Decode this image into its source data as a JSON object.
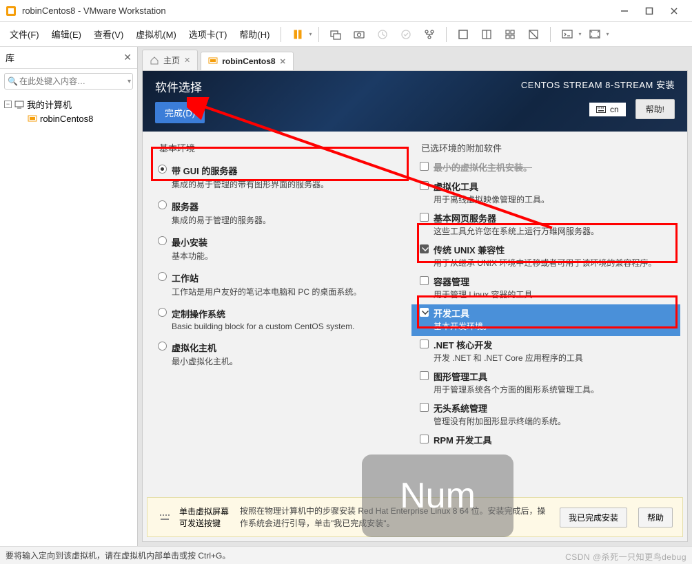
{
  "window": {
    "title": "robinCentos8 - VMware Workstation",
    "minimize": "—",
    "maximize": "□",
    "close": "✕"
  },
  "menu": {
    "file": "文件(F)",
    "edit": "编辑(E)",
    "view": "查看(V)",
    "vm": "虚拟机(M)",
    "tabs": "选项卡(T)",
    "help": "帮助(H)"
  },
  "sidebar": {
    "title": "库",
    "search_placeholder": "在此处键入内容…",
    "tree": {
      "root": "我的计算机",
      "child": "robinCentos8"
    }
  },
  "tabs": {
    "home": "主页",
    "vm": "robinCentos8"
  },
  "installer": {
    "title": "软件选择",
    "done": "完成(D)",
    "product": "CENTOS STREAM 8-STREAM 安装",
    "keyboard": "cn",
    "help": "帮助!"
  },
  "env": {
    "heading": "基本环境",
    "items": [
      {
        "title": "带 GUI 的服务器",
        "desc": "集成的易于管理的带有图形界面的服务器。",
        "checked": true
      },
      {
        "title": "服务器",
        "desc": "集成的易于管理的服务器。",
        "checked": false
      },
      {
        "title": "最小安装",
        "desc": "基本功能。",
        "checked": false
      },
      {
        "title": "工作站",
        "desc": "工作站是用户友好的笔记本电脑和 PC 的桌面系统。",
        "checked": false
      },
      {
        "title": "定制操作系统",
        "desc": "Basic building block for a custom CentOS system.",
        "checked": false
      },
      {
        "title": "虚拟化主机",
        "desc": "最小虚拟化主机。",
        "checked": false
      }
    ]
  },
  "addons": {
    "heading": "已选环境的附加软件",
    "items": [
      {
        "title": "虚拟化工具",
        "desc": "用于离线虚拟映像管理的工具。",
        "checked": false
      },
      {
        "title": "基本网页服务器",
        "desc": "这些工具允许您在系统上运行万维网服务器。",
        "checked": false
      },
      {
        "title": "传统 UNIX 兼容性",
        "desc": "用于从继承 UNIX 环境中迁移或者可用于该环境的兼容程序。",
        "checked": true
      },
      {
        "title": "容器管理",
        "desc": "用于管理 Linux 容器的工具",
        "checked": false
      },
      {
        "title": "开发工具",
        "desc": "基本开发环境。",
        "checked": true,
        "selected": true
      },
      {
        "title": ".NET 核心开发",
        "desc": "开发 .NET 和 .NET Core 应用程序的工具",
        "checked": false
      },
      {
        "title": "图形管理工具",
        "desc": "用于管理系统各个方面的图形系统管理工具。",
        "checked": false
      },
      {
        "title": "无头系统管理",
        "desc": "管理没有附加图形显示终端的系统。",
        "checked": false
      },
      {
        "title": "RPM 开发工具",
        "desc": "",
        "checked": false
      }
    ]
  },
  "hint": {
    "left_line1": "单击虚拟屏幕",
    "left_line2": "可发送按键",
    "text": "按照在物理计算机中的步骤安装 Red Hat Enterprise Linux 8 64 位。安装完成后，操作系统会进行引导，单击\"我已完成安装\"。",
    "btn_done": "我已完成安装",
    "btn_help": "帮助"
  },
  "status": {
    "text": "要将输入定向到该虚拟机，请在虚拟机内部单击或按 Ctrl+G。"
  },
  "overlay": {
    "num": "Num"
  },
  "watermark": "CSDN @杀死一只知更鸟debug"
}
